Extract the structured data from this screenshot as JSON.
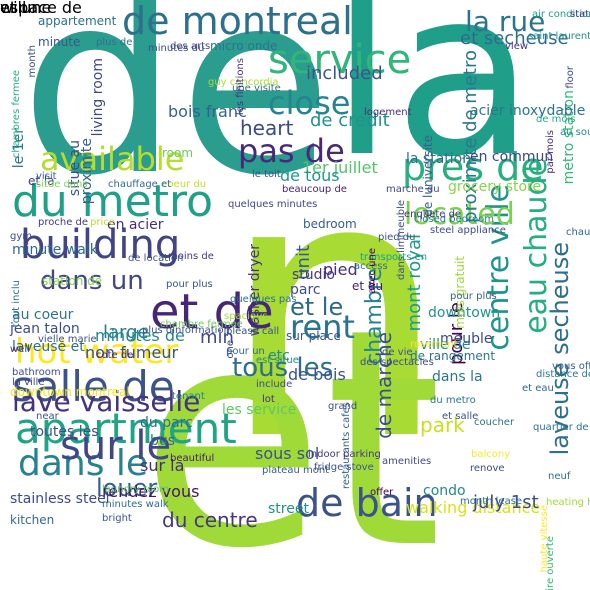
{
  "words": [
    {
      "text": "de",
      "color": "#2a9d8f"
    },
    {
      "text": "la",
      "color": "#1f9e89"
    },
    {
      "text": "n",
      "color": "#a8db34"
    },
    {
      "text": "et",
      "color": "#a0da39"
    },
    {
      "text": "de montreal",
      "color": "#2d708e"
    },
    {
      "text": "service",
      "color": "#31b57b"
    },
    {
      "text": "close",
      "color": "#25858e"
    },
    {
      "text": "available",
      "color": "#b5de2b"
    },
    {
      "text": "du metro",
      "color": "#1fa187"
    },
    {
      "text": "building",
      "color": "#414487"
    },
    {
      "text": "et de",
      "color": "#482677"
    },
    {
      "text": "hot water",
      "color": "#fde725"
    },
    {
      "text": "salle de",
      "color": "#3b528b"
    },
    {
      "text": "apartment",
      "color": "#20a486"
    },
    {
      "text": "dans le",
      "color": "#26828e"
    },
    {
      "text": "sur le",
      "color": "#3f4788"
    },
    {
      "text": "de bain",
      "color": "#3b528b"
    },
    {
      "text": "centre ville",
      "color": "#1f948c"
    },
    {
      "text": "eau chaude",
      "color": "#26ad81"
    },
    {
      "text": "laveuse secheuse",
      "color": "#2e6f8e"
    },
    {
      "text": "pres de",
      "color": "#29af7f"
    },
    {
      "text": "pas de",
      "color": "#482878"
    },
    {
      "text": "located",
      "color": "#7ad151"
    },
    {
      "text": "rent",
      "color": "#2c728e"
    },
    {
      "text": "lave vaisselle",
      "color": "#46327e"
    },
    {
      "text": "tous les",
      "color": "#2f6c8e"
    },
    {
      "text": "heart",
      "color": "#3e4989"
    },
    {
      "text": "dans un",
      "color": "#404688"
    },
    {
      "text": "louer",
      "color": "#355f8d"
    },
    {
      "text": "du centre",
      "color": "#453781"
    },
    {
      "text": "et le",
      "color": "#31688e"
    },
    {
      "text": "la rue",
      "color": "#2c738e"
    },
    {
      "text": "et secheuse",
      "color": "#2f6b8e"
    },
    {
      "text": "proximite de metro",
      "color": "#2a788e"
    },
    {
      "text": "mont royal",
      "color": "#1e9b8a"
    },
    {
      "text": "chambre",
      "color": "#24878e"
    },
    {
      "text": "de marche",
      "color": "#3d4d8a"
    },
    {
      "text": "included",
      "color": "#39568c"
    },
    {
      "text": "de credit",
      "color": "#20928c"
    },
    {
      "text": "bois franc",
      "color": "#33638d"
    },
    {
      "text": "1er juillet",
      "color": "#52c569"
    },
    {
      "text": "de tous",
      "color": "#1f988b"
    },
    {
      "text": "la station",
      "color": "#2e6e8e"
    },
    {
      "text": "en commun",
      "color": "#404588"
    },
    {
      "text": "grocery store",
      "color": "#86d549"
    },
    {
      "text": "metro station",
      "color": "#35b779"
    },
    {
      "text": "au sous",
      "color": "#24868e"
    },
    {
      "text": "pour le",
      "color": "#440154"
    },
    {
      "text": "de rangement",
      "color": "#2b748e"
    },
    {
      "text": "dans la",
      "color": "#2a778e"
    },
    {
      "text": "park",
      "color": "#c8e020"
    },
    {
      "text": "condo",
      "color": "#23898e"
    },
    {
      "text": "walking distance",
      "color": "#d8e219"
    },
    {
      "text": "july 1st",
      "color": "#3e4a89"
    },
    {
      "text": "downtown",
      "color": "#1f958b"
    },
    {
      "text": "meuble",
      "color": "#3f4889"
    },
    {
      "text": "ville de",
      "color": "#23888e"
    },
    {
      "text": "mois gratuit",
      "color": "#9bd93c"
    },
    {
      "text": "pour plus",
      "color": "#365d8d"
    },
    {
      "text": "sur place",
      "color": "#39558c"
    },
    {
      "text": "de bois",
      "color": "#3a548c"
    },
    {
      "text": "etc",
      "color": "#228b8d"
    },
    {
      "text": "parc",
      "color": "#3e4a89"
    },
    {
      "text": "studio",
      "color": "#453882"
    },
    {
      "text": "et du",
      "color": "#481c6e"
    },
    {
      "text": "pied",
      "color": "#472d7b"
    },
    {
      "text": "bedroom",
      "color": "#355e8d"
    },
    {
      "text": "unit",
      "color": "#38598c"
    },
    {
      "text": "washer dryer",
      "color": "#46337f"
    },
    {
      "text": "large",
      "color": "#287c8e"
    },
    {
      "text": "en acier",
      "color": "#46307e"
    },
    {
      "text": "station de",
      "color": "#84d44b"
    },
    {
      "text": "au coeur",
      "color": "#2b758e"
    },
    {
      "text": "jean talon",
      "color": "#3e4c8a"
    },
    {
      "text": "minutes de",
      "color": "#24878e"
    },
    {
      "text": "min",
      "color": "#3f4788"
    },
    {
      "text": "laveuse et",
      "color": "#2e6d8e"
    },
    {
      "text": "non fumeur",
      "color": "#3a538b"
    },
    {
      "text": "downtown montreal",
      "color": "#efe51c"
    },
    {
      "text": "toutes les",
      "color": "#3d4e8a"
    },
    {
      "text": "bus",
      "color": "#31688e"
    },
    {
      "text": "du parc",
      "color": "#2d708e"
    },
    {
      "text": "sur la",
      "color": "#472c7a"
    },
    {
      "text": "rendez vous",
      "color": "#481467"
    },
    {
      "text": "stainless steel",
      "color": "#3e4989"
    },
    {
      "text": "kitchen",
      "color": "#2f6b8e"
    },
    {
      "text": "sous sol",
      "color": "#3b518b"
    },
    {
      "text": "les service",
      "color": "#5ec962"
    },
    {
      "text": "street",
      "color": "#21918c"
    },
    {
      "text": "le 1er",
      "color": "#2d718e"
    },
    {
      "text": "appartement",
      "color": "#2e6f8e"
    },
    {
      "text": "minute",
      "color": "#39568c"
    },
    {
      "text": "situe au",
      "color": "#3c4f8a"
    },
    {
      "text": "proximite",
      "color": "#355f8d"
    },
    {
      "text": "living room",
      "color": "#3f4889"
    },
    {
      "text": "room",
      "color": "#6ccd5a"
    },
    {
      "text": "micro onde",
      "color": "#2c738e"
    },
    {
      "text": "de luniversite",
      "color": "#34618d"
    },
    {
      "text": "acier inoxydable",
      "color": "#2a768e"
    },
    {
      "text": "et la",
      "color": "#443a83"
    },
    {
      "text": "coeur du",
      "color": "#c2df23"
    },
    {
      "text": "chauffage et",
      "color": "#2e6e8e"
    },
    {
      "text": "minute walk",
      "color": "#306a8e"
    },
    {
      "text": "de location",
      "color": "#3b528b"
    },
    {
      "text": "closed bedroom",
      "color": "#277f8e"
    },
    {
      "text": "steel appliance",
      "color": "#3e4a89"
    },
    {
      "text": "dans limmeuble",
      "color": "#3d4e8a"
    },
    {
      "text": "chambres fermee",
      "color": "#29af7f"
    },
    {
      "text": "month",
      "color": "#3c508b"
    },
    {
      "text": "une visite",
      "color": "#2f6c8e"
    },
    {
      "text": "air conditioning",
      "color": "#1e9c89"
    },
    {
      "text": "stationnement interieur",
      "color": "#404588"
    },
    {
      "text": "saint laurent",
      "color": "#20928c"
    },
    {
      "text": "view",
      "color": "#46317e"
    },
    {
      "text": "floor",
      "color": "#3e4989"
    },
    {
      "text": "par mois",
      "color": "#472a7a"
    },
    {
      "text": "du metro",
      "color": "#2a778e"
    },
    {
      "text": "de vie",
      "color": "#3b528b"
    },
    {
      "text": "restaurants cafes",
      "color": "#355e8d"
    },
    {
      "text": "fridge stove",
      "color": "#39568c"
    },
    {
      "text": "amenities",
      "color": "#3f4788"
    },
    {
      "text": "indoor parking",
      "color": "#453781"
    },
    {
      "text": "heating hot",
      "color": "#a2da37"
    },
    {
      "text": "bathroom",
      "color": "#3e4c8a"
    },
    {
      "text": "la ville",
      "color": "#404588"
    },
    {
      "text": "cote de",
      "color": "#472d7b"
    },
    {
      "text": "plus dinformation",
      "color": "#3b518b"
    },
    {
      "text": "plateau mont",
      "color": "#38588c"
    },
    {
      "text": "minutes walk",
      "color": "#2f6c8e"
    },
    {
      "text": "laundry room",
      "color": "#5ac864"
    },
    {
      "text": "beautiful",
      "color": "#481769"
    },
    {
      "text": "offer",
      "color": "#440154"
    },
    {
      "text": "bright",
      "color": "#3b528b"
    },
    {
      "text": "month lease",
      "color": "#2e6f8e"
    },
    {
      "text": "balcony",
      "color": "#fde725"
    },
    {
      "text": "renove",
      "color": "#3e4989"
    },
    {
      "text": "et salle",
      "color": "#3b528b"
    },
    {
      "text": "coucher",
      "color": "#2c728e"
    },
    {
      "text": "et eau",
      "color": "#31688e"
    },
    {
      "text": "vous offre",
      "color": "#355f8d"
    },
    {
      "text": "distance de",
      "color": "#2a788e"
    },
    {
      "text": "quartier de",
      "color": "#2d708e"
    },
    {
      "text": "est situe",
      "color": "#24878e"
    },
    {
      "text": "pour un",
      "color": "#31688e"
    },
    {
      "text": "rosemont",
      "color": "#fde725"
    },
    {
      "text": "logement",
      "color": "#472d7b"
    },
    {
      "text": "guy concordia",
      "color": "#a8db34"
    },
    {
      "text": "minutes du",
      "color": "#3e4c8a"
    },
    {
      "text": "des arts",
      "color": "#3f4788"
    },
    {
      "text": "plus de",
      "color": "#2c738e"
    },
    {
      "text": "de mois",
      "color": "#26ad81"
    },
    {
      "text": "proche de",
      "color": "#453781"
    },
    {
      "text": "visit",
      "color": "#355e8d"
    },
    {
      "text": "situe dans",
      "color": "#7ad151"
    },
    {
      "text": "price",
      "color": "#b5de2b"
    },
    {
      "text": "gym",
      "color": "#3e4a89"
    },
    {
      "text": "tout inclu",
      "color": "#2d718e"
    },
    {
      "text": "well",
      "color": "#46327e"
    },
    {
      "text": "moins de",
      "color": "#453882"
    },
    {
      "text": "please call",
      "color": "#3b528b"
    },
    {
      "text": "des spectacles",
      "color": "#404688"
    },
    {
      "text": "access",
      "color": "#2f6c8e"
    },
    {
      "text": "transports en",
      "color": "#1f9e89"
    },
    {
      "text": "pied du",
      "color": "#3a548c"
    },
    {
      "text": "chauffage eau",
      "color": "#33638d"
    },
    {
      "text": "avec une",
      "color": "#440154"
    },
    {
      "text": "marche du",
      "color": "#3e4989"
    },
    {
      "text": "beaucoup de",
      "color": "#482475"
    },
    {
      "text": "enquete de",
      "color": "#453781"
    },
    {
      "text": "quelques minutes",
      "color": "#3f4788"
    },
    {
      "text": "haute vitesse",
      "color": "#fde725"
    },
    {
      "text": "aire ouverte",
      "color": "#35b779"
    },
    {
      "text": "chambre fermee",
      "color": "#6ccd5a"
    },
    {
      "text": "spacious",
      "color": "#a0da39"
    },
    {
      "text": "quelques pas",
      "color": "#2d708e"
    },
    {
      "text": "vielle marie",
      "color": "#3b528b"
    },
    {
      "text": "tenant",
      "color": "#26828e"
    },
    {
      "text": "near",
      "color": "#3b528b"
    },
    {
      "text": "lot",
      "color": "#472d7b"
    },
    {
      "text": "include",
      "color": "#3e4989"
    },
    {
      "text": "neuf",
      "color": "#2e6e8e"
    },
    {
      "text": "grand",
      "color": "#3e4c8a"
    },
    {
      "text": "le toit",
      "color": "#3a548c"
    },
    {
      "text": "les finitions",
      "color": "#46327e"
    },
    {
      "text": "pour plus",
      "color": "#3b528b"
    },
    {
      "text": "one",
      "color": "#3e4a89"
    },
    {
      "text": "et un",
      "color": "#481769"
    },
    {
      "text": "will",
      "color": "#3b528b"
    },
    {
      "text": "et une",
      "color": "#440154"
    },
    {
      "text": "espace de",
      "color": "#a8db34"
    }
  ]
}
